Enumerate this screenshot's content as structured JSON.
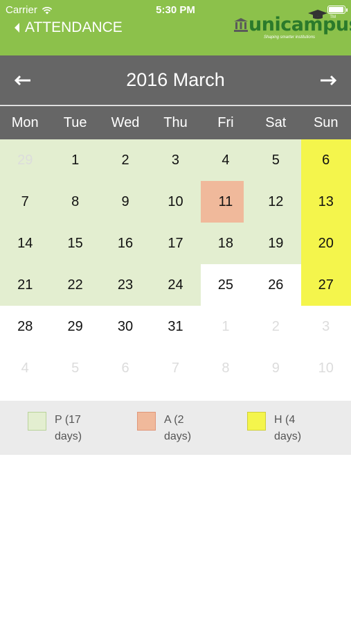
{
  "status_bar": {
    "carrier": "Carrier",
    "time": "5:30 PM"
  },
  "nav": {
    "back_label": "ATTENDANCE"
  },
  "logo": {
    "text": "unicampus",
    "tagline": "Shaping smarter institutions",
    "tm": "TM"
  },
  "calendar": {
    "title": "2016 March",
    "prev_icon": "left-arrow",
    "next_icon": "right-arrow",
    "weekdays": [
      "Mon",
      "Tue",
      "Wed",
      "Thu",
      "Fri",
      "Sat",
      "Sun"
    ],
    "days": [
      {
        "label": "29",
        "state": "present-other"
      },
      {
        "label": "1",
        "state": "present"
      },
      {
        "label": "2",
        "state": "present"
      },
      {
        "label": "3",
        "state": "present"
      },
      {
        "label": "4",
        "state": "present"
      },
      {
        "label": "5",
        "state": "present"
      },
      {
        "label": "6",
        "state": "holiday"
      },
      {
        "label": "7",
        "state": "present"
      },
      {
        "label": "8",
        "state": "present"
      },
      {
        "label": "9",
        "state": "present"
      },
      {
        "label": "10",
        "state": "present"
      },
      {
        "label": "11",
        "state": "absent"
      },
      {
        "label": "12",
        "state": "present"
      },
      {
        "label": "13",
        "state": "holiday"
      },
      {
        "label": "14",
        "state": "present"
      },
      {
        "label": "15",
        "state": "present"
      },
      {
        "label": "16",
        "state": "present"
      },
      {
        "label": "17",
        "state": "present"
      },
      {
        "label": "18",
        "state": "present"
      },
      {
        "label": "19",
        "state": "present"
      },
      {
        "label": "20",
        "state": "holiday"
      },
      {
        "label": "21",
        "state": "present"
      },
      {
        "label": "22",
        "state": "present"
      },
      {
        "label": "23",
        "state": "present"
      },
      {
        "label": "24",
        "state": "present"
      },
      {
        "label": "25",
        "state": "none"
      },
      {
        "label": "26",
        "state": "none"
      },
      {
        "label": "27",
        "state": "holiday"
      },
      {
        "label": "28",
        "state": "none"
      },
      {
        "label": "29",
        "state": "none"
      },
      {
        "label": "30",
        "state": "none"
      },
      {
        "label": "31",
        "state": "none"
      },
      {
        "label": "1",
        "state": "other"
      },
      {
        "label": "2",
        "state": "other"
      },
      {
        "label": "3",
        "state": "other"
      },
      {
        "label": "4",
        "state": "other"
      },
      {
        "label": "5",
        "state": "other"
      },
      {
        "label": "6",
        "state": "other"
      },
      {
        "label": "7",
        "state": "other"
      },
      {
        "label": "8",
        "state": "other"
      },
      {
        "label": "9",
        "state": "other"
      },
      {
        "label": "10",
        "state": "other"
      }
    ]
  },
  "legend": [
    {
      "label": "P (17 days)",
      "color": "#e3eed0",
      "border": "#b9d39a"
    },
    {
      "label": "A (2 days)",
      "color": "#f0b99b",
      "border": "#e0977a"
    },
    {
      "label": "H (4 days)",
      "color": "#f4f54c",
      "border": "#cfcf3a"
    }
  ],
  "colors": {
    "header_green": "#8cc14b",
    "month_bar_gray": "#666666",
    "present": "#e3eed0",
    "absent": "#f0b99b",
    "holiday": "#f4f54c"
  }
}
